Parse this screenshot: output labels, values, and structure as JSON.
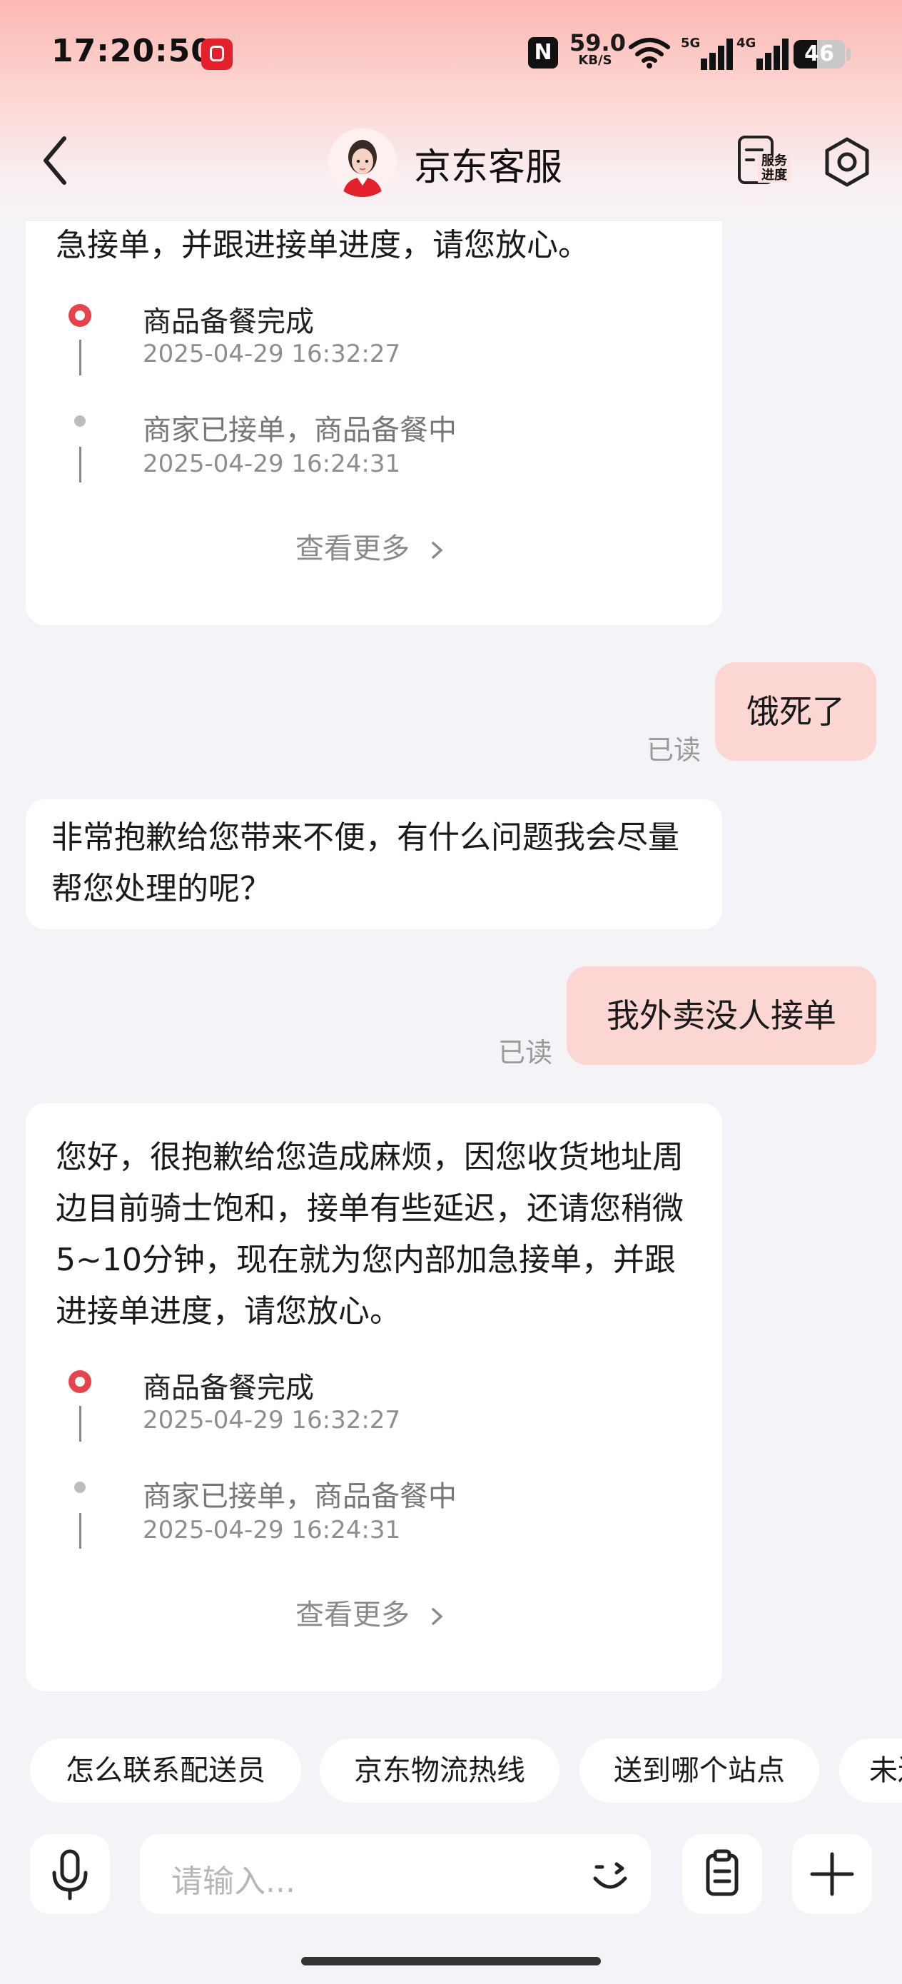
{
  "status_bar": {
    "time": "17:20:50",
    "speed_value": "59.0",
    "speed_unit": "KB/S",
    "nfc_label": "N",
    "sig1_tag": "5G",
    "sig2_tag": "4G",
    "battery_level": "46",
    "battery_fraction": 0.46,
    "icons": [
      "jd-app-icon",
      "nfc-icon",
      "wifi-icon",
      "signal-5g-icon",
      "signal-4g-icon",
      "battery-icon"
    ]
  },
  "header": {
    "title": "京东客服",
    "service_progress_label": "服务进度",
    "icons": [
      "back-chevron-icon",
      "agent-avatar",
      "service-progress-icon",
      "settings-icon"
    ]
  },
  "messages": [
    {
      "role": "agent",
      "text_partial": "急接单，并跟进接单进度，请您放心。",
      "timeline": [
        {
          "status": "商品备餐完成",
          "time": "2025-04-29 16:32:27",
          "active": true
        },
        {
          "status": "商家已接单，商品备餐中",
          "time": "2025-04-29 16:24:31",
          "active": false
        }
      ],
      "more_label": "查看更多"
    },
    {
      "role": "user",
      "text": "饿死了",
      "read_label": "已读"
    },
    {
      "role": "agent",
      "text": "非常抱歉给您带来不便，有什么问题我会尽量帮您处理的呢？"
    },
    {
      "role": "user",
      "text": "我外卖没人接单",
      "read_label": "已读"
    },
    {
      "role": "agent",
      "text": "您好，很抱歉给您造成麻烦，因您收货地址周边目前骑士饱和，接单有些延迟，还请您稍微5~10分钟，现在就为您内部加急接单，并跟进接单进度，请您放心。",
      "timeline": [
        {
          "status": "商品备餐完成",
          "time": "2025-04-29 16:32:27",
          "active": true
        },
        {
          "status": "商家已接单，商品备餐中",
          "time": "2025-04-29 16:24:31",
          "active": false
        }
      ],
      "more_label": "查看更多"
    }
  ],
  "quick_replies": [
    "怎么联系配送员",
    "京东物流热线",
    "送到哪个站点",
    "未送"
  ],
  "input_bar": {
    "placeholder": "请输入...",
    "icons": [
      "microphone-icon",
      "emoji-icon",
      "clipboard-icon",
      "plus-icon"
    ]
  },
  "colors": {
    "accent_red": "#e8434d",
    "user_bubble": "#fcd6d3",
    "page_bg": "#f4f4f8"
  }
}
